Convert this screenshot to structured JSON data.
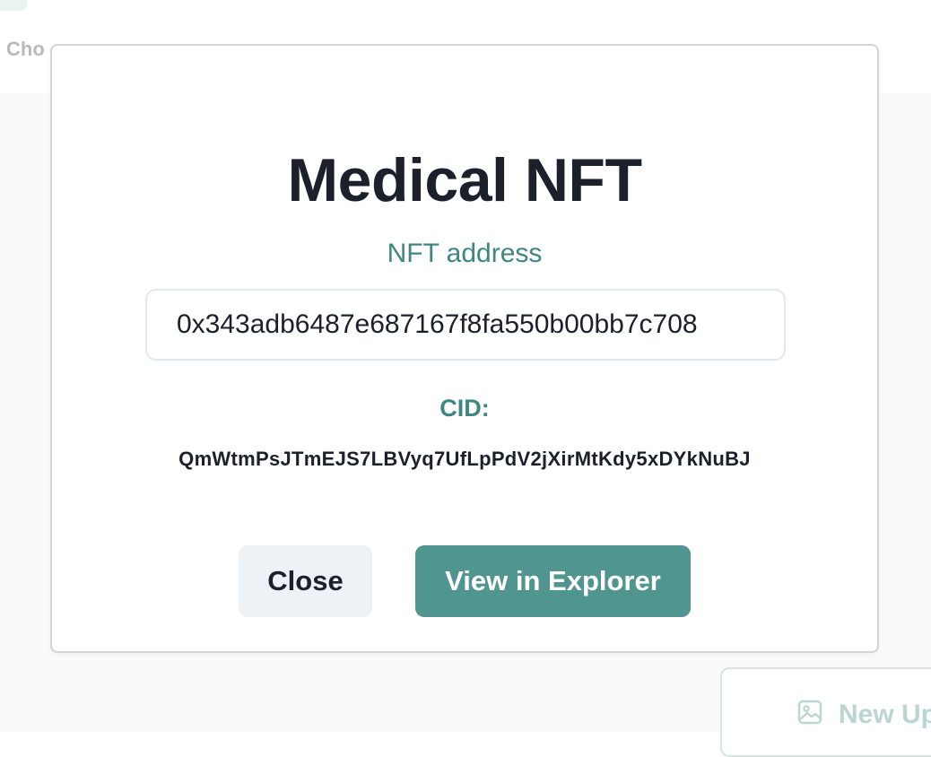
{
  "background": {
    "choose_text": "Cho",
    "upload_button_label": "New Up"
  },
  "modal": {
    "title": "Medical NFT",
    "nft_address_label": "NFT address",
    "nft_address_value": "0x343adb6487e687167f8fa550b00bb7c708",
    "cid_label": "CID:",
    "cid_value": "QmWtmPsJTmEJS7LBVyq7UfLpPdV2jXirMtKdy5xDYkNuBJ",
    "close_button": "Close",
    "explorer_button": "View in Explorer"
  },
  "colors": {
    "accent": "#519590",
    "accent_text": "#3e8680",
    "title_text": "#1b202b",
    "secondary_button_bg": "#edf2f7"
  },
  "icons": {
    "upload_icon": "image-icon"
  }
}
